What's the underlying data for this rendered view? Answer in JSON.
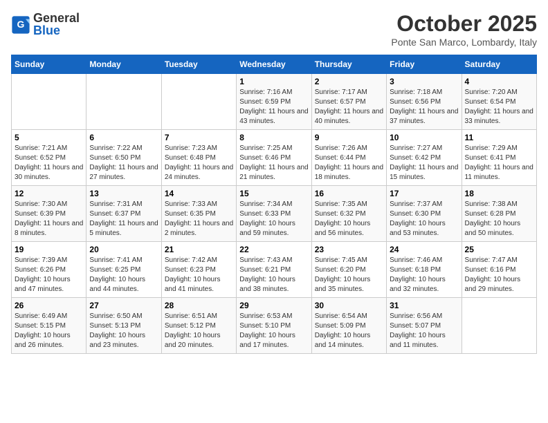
{
  "header": {
    "logo_line1": "General",
    "logo_line2": "Blue",
    "month": "October 2025",
    "location": "Ponte San Marco, Lombardy, Italy"
  },
  "days_of_week": [
    "Sunday",
    "Monday",
    "Tuesday",
    "Wednesday",
    "Thursday",
    "Friday",
    "Saturday"
  ],
  "weeks": [
    [
      {
        "num": "",
        "info": ""
      },
      {
        "num": "",
        "info": ""
      },
      {
        "num": "",
        "info": ""
      },
      {
        "num": "1",
        "info": "Sunrise: 7:16 AM\nSunset: 6:59 PM\nDaylight: 11 hours and 43 minutes."
      },
      {
        "num": "2",
        "info": "Sunrise: 7:17 AM\nSunset: 6:57 PM\nDaylight: 11 hours and 40 minutes."
      },
      {
        "num": "3",
        "info": "Sunrise: 7:18 AM\nSunset: 6:56 PM\nDaylight: 11 hours and 37 minutes."
      },
      {
        "num": "4",
        "info": "Sunrise: 7:20 AM\nSunset: 6:54 PM\nDaylight: 11 hours and 33 minutes."
      }
    ],
    [
      {
        "num": "5",
        "info": "Sunrise: 7:21 AM\nSunset: 6:52 PM\nDaylight: 11 hours and 30 minutes."
      },
      {
        "num": "6",
        "info": "Sunrise: 7:22 AM\nSunset: 6:50 PM\nDaylight: 11 hours and 27 minutes."
      },
      {
        "num": "7",
        "info": "Sunrise: 7:23 AM\nSunset: 6:48 PM\nDaylight: 11 hours and 24 minutes."
      },
      {
        "num": "8",
        "info": "Sunrise: 7:25 AM\nSunset: 6:46 PM\nDaylight: 11 hours and 21 minutes."
      },
      {
        "num": "9",
        "info": "Sunrise: 7:26 AM\nSunset: 6:44 PM\nDaylight: 11 hours and 18 minutes."
      },
      {
        "num": "10",
        "info": "Sunrise: 7:27 AM\nSunset: 6:42 PM\nDaylight: 11 hours and 15 minutes."
      },
      {
        "num": "11",
        "info": "Sunrise: 7:29 AM\nSunset: 6:41 PM\nDaylight: 11 hours and 11 minutes."
      }
    ],
    [
      {
        "num": "12",
        "info": "Sunrise: 7:30 AM\nSunset: 6:39 PM\nDaylight: 11 hours and 8 minutes."
      },
      {
        "num": "13",
        "info": "Sunrise: 7:31 AM\nSunset: 6:37 PM\nDaylight: 11 hours and 5 minutes."
      },
      {
        "num": "14",
        "info": "Sunrise: 7:33 AM\nSunset: 6:35 PM\nDaylight: 11 hours and 2 minutes."
      },
      {
        "num": "15",
        "info": "Sunrise: 7:34 AM\nSunset: 6:33 PM\nDaylight: 10 hours and 59 minutes."
      },
      {
        "num": "16",
        "info": "Sunrise: 7:35 AM\nSunset: 6:32 PM\nDaylight: 10 hours and 56 minutes."
      },
      {
        "num": "17",
        "info": "Sunrise: 7:37 AM\nSunset: 6:30 PM\nDaylight: 10 hours and 53 minutes."
      },
      {
        "num": "18",
        "info": "Sunrise: 7:38 AM\nSunset: 6:28 PM\nDaylight: 10 hours and 50 minutes."
      }
    ],
    [
      {
        "num": "19",
        "info": "Sunrise: 7:39 AM\nSunset: 6:26 PM\nDaylight: 10 hours and 47 minutes."
      },
      {
        "num": "20",
        "info": "Sunrise: 7:41 AM\nSunset: 6:25 PM\nDaylight: 10 hours and 44 minutes."
      },
      {
        "num": "21",
        "info": "Sunrise: 7:42 AM\nSunset: 6:23 PM\nDaylight: 10 hours and 41 minutes."
      },
      {
        "num": "22",
        "info": "Sunrise: 7:43 AM\nSunset: 6:21 PM\nDaylight: 10 hours and 38 minutes."
      },
      {
        "num": "23",
        "info": "Sunrise: 7:45 AM\nSunset: 6:20 PM\nDaylight: 10 hours and 35 minutes."
      },
      {
        "num": "24",
        "info": "Sunrise: 7:46 AM\nSunset: 6:18 PM\nDaylight: 10 hours and 32 minutes."
      },
      {
        "num": "25",
        "info": "Sunrise: 7:47 AM\nSunset: 6:16 PM\nDaylight: 10 hours and 29 minutes."
      }
    ],
    [
      {
        "num": "26",
        "info": "Sunrise: 6:49 AM\nSunset: 5:15 PM\nDaylight: 10 hours and 26 minutes."
      },
      {
        "num": "27",
        "info": "Sunrise: 6:50 AM\nSunset: 5:13 PM\nDaylight: 10 hours and 23 minutes."
      },
      {
        "num": "28",
        "info": "Sunrise: 6:51 AM\nSunset: 5:12 PM\nDaylight: 10 hours and 20 minutes."
      },
      {
        "num": "29",
        "info": "Sunrise: 6:53 AM\nSunset: 5:10 PM\nDaylight: 10 hours and 17 minutes."
      },
      {
        "num": "30",
        "info": "Sunrise: 6:54 AM\nSunset: 5:09 PM\nDaylight: 10 hours and 14 minutes."
      },
      {
        "num": "31",
        "info": "Sunrise: 6:56 AM\nSunset: 5:07 PM\nDaylight: 10 hours and 11 minutes."
      },
      {
        "num": "",
        "info": ""
      }
    ]
  ]
}
